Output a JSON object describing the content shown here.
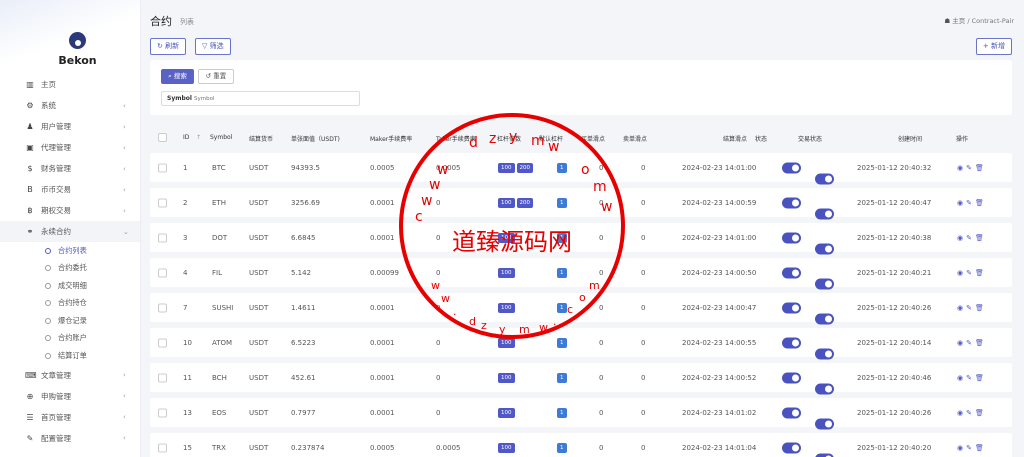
{
  "brand": "Bekon",
  "sidebar": {
    "items": [
      {
        "label": "主页",
        "icon": "bar-chart-icon",
        "glyph": "▥",
        "chev": ""
      },
      {
        "label": "系统",
        "icon": "gear-icon",
        "glyph": "⚙",
        "chev": "‹"
      },
      {
        "label": "用户管理",
        "icon": "user-icon",
        "glyph": "♟",
        "chev": "‹"
      },
      {
        "label": "代理管理",
        "icon": "id-card-icon",
        "glyph": "▣",
        "chev": "‹"
      },
      {
        "label": "财务管理",
        "icon": "dollar-icon",
        "glyph": "$",
        "chev": "‹"
      },
      {
        "label": "币币交易",
        "icon": "bitcoin-icon",
        "glyph": "B",
        "chev": "‹"
      },
      {
        "label": "期权交易",
        "icon": "bitcoin-icon",
        "glyph": "฿",
        "chev": "‹"
      },
      {
        "label": "永续合约",
        "icon": "link-icon",
        "glyph": "⚭",
        "chev": "⌄"
      }
    ],
    "sub_items": [
      {
        "label": "合约列表",
        "active": true
      },
      {
        "label": "合约委托",
        "active": false
      },
      {
        "label": "成交明细",
        "active": false
      },
      {
        "label": "合约持仓",
        "active": false
      },
      {
        "label": "爆仓记录",
        "active": false
      },
      {
        "label": "合约账户",
        "active": false
      },
      {
        "label": "结算订单",
        "active": false
      }
    ],
    "items_after": [
      {
        "label": "文章管理",
        "icon": "keyboard-icon",
        "glyph": "⌨",
        "chev": "‹"
      },
      {
        "label": "申购管理",
        "icon": "globe-icon",
        "glyph": "⊕",
        "chev": "‹"
      },
      {
        "label": "首页管理",
        "icon": "list-icon",
        "glyph": "☰",
        "chev": "‹"
      },
      {
        "label": "配置管理",
        "icon": "wrench-icon",
        "glyph": "✎",
        "chev": "‹"
      }
    ]
  },
  "header": {
    "title": "合约",
    "subtitle": "列表",
    "breadcrumb_home": "主页",
    "breadcrumb_sep": "/",
    "breadcrumb_current": "Contract-Pair"
  },
  "toolbar": {
    "refresh_label": "刷新",
    "filter_label": "筛选",
    "add_label": "新增"
  },
  "search": {
    "search_label": "搜索",
    "reset_label": "重置",
    "field_label": "Symbol",
    "field_placeholder": "Symbol"
  },
  "table": {
    "headers": [
      "ID",
      "Symbol",
      "结算货币",
      "单张面值（USDT)",
      "Maker手续费率",
      "Taker手续费率",
      "杠杆倍数",
      "默认杠杆",
      "买单滑点",
      "卖单滑点",
      "结算滑点",
      "状态",
      "交易状态",
      "创建时间",
      "操作"
    ],
    "sort_icon": "↑",
    "rows": [
      {
        "id": "1",
        "symbol": "BTC",
        "currency": "USDT",
        "face": "94393.5",
        "maker": "0.0005",
        "taker": "0.0005",
        "leverage": [
          "100",
          "200"
        ],
        "default_lev": "1",
        "buy": "0",
        "sell": "0",
        "settle": "2024-02-23 14:01:00",
        "created": "2025-01-12 20:40:32"
      },
      {
        "id": "2",
        "symbol": "ETH",
        "currency": "USDT",
        "face": "3256.69",
        "maker": "0.0001",
        "taker": "0",
        "leverage": [
          "100",
          "200"
        ],
        "default_lev": "1",
        "buy": "0",
        "sell": "0",
        "settle": "2024-02-23 14:00:59",
        "created": "2025-01-12 20:40:47"
      },
      {
        "id": "3",
        "symbol": "DOT",
        "currency": "USDT",
        "face": "6.6845",
        "maker": "0.0001",
        "taker": "0",
        "leverage": [
          "100"
        ],
        "default_lev": "1",
        "buy": "0",
        "sell": "0",
        "settle": "2024-02-23 14:01:00",
        "created": "2025-01-12 20:40:38"
      },
      {
        "id": "4",
        "symbol": "FIL",
        "currency": "USDT",
        "face": "5.142",
        "maker": "0.00099",
        "taker": "0",
        "leverage": [
          "100"
        ],
        "default_lev": "1",
        "buy": "0",
        "sell": "0",
        "settle": "2024-02-23 14:00:50",
        "created": "2025-01-12 20:40:21"
      },
      {
        "id": "7",
        "symbol": "SUSHI",
        "currency": "USDT",
        "face": "1.4611",
        "maker": "0.0001",
        "taker": "0",
        "leverage": [
          "100"
        ],
        "default_lev": "1",
        "buy": "0",
        "sell": "0",
        "settle": "2024-02-23 14:00:47",
        "created": "2025-01-12 20:40:26"
      },
      {
        "id": "10",
        "symbol": "ATOM",
        "currency": "USDT",
        "face": "6.5223",
        "maker": "0.0001",
        "taker": "0",
        "leverage": [
          "100"
        ],
        "default_lev": "1",
        "buy": "0",
        "sell": "0",
        "settle": "2024-02-23 14:00:55",
        "created": "2025-01-12 20:40:14"
      },
      {
        "id": "11",
        "symbol": "BCH",
        "currency": "USDT",
        "face": "452.61",
        "maker": "0.0001",
        "taker": "0",
        "leverage": [
          "100"
        ],
        "default_lev": "1",
        "buy": "0",
        "sell": "0",
        "settle": "2024-02-23 14:00:52",
        "created": "2025-01-12 20:40:46"
      },
      {
        "id": "13",
        "symbol": "EOS",
        "currency": "USDT",
        "face": "0.7977",
        "maker": "0.0001",
        "taker": "0",
        "leverage": [
          "100"
        ],
        "default_lev": "1",
        "buy": "0",
        "sell": "0",
        "settle": "2024-02-23 14:01:02",
        "created": "2025-01-12 20:40:26"
      },
      {
        "id": "15",
        "symbol": "TRX",
        "currency": "USDT",
        "face": "0.237874",
        "maker": "0.0005",
        "taker": "0.0005",
        "leverage": [
          "100"
        ],
        "default_lev": "1",
        "buy": "0",
        "sell": "0",
        "settle": "2024-02-23 14:01:04",
        "created": "2025-01-12 20:40:20"
      }
    ]
  },
  "watermark": {
    "text": "道臻源码网",
    "letters": [
      "d",
      "z",
      "y",
      "m",
      "w",
      "w",
      "w",
      "w",
      "c",
      "o",
      "m",
      "w",
      "w",
      "w",
      ".",
      "d",
      "z",
      "y",
      "m",
      "w",
      ".",
      "c",
      "o",
      "m"
    ]
  },
  "colors": {
    "accent": "#5058c8",
    "stamp": "#e60000",
    "badge_blue": "#3d7bd6"
  }
}
